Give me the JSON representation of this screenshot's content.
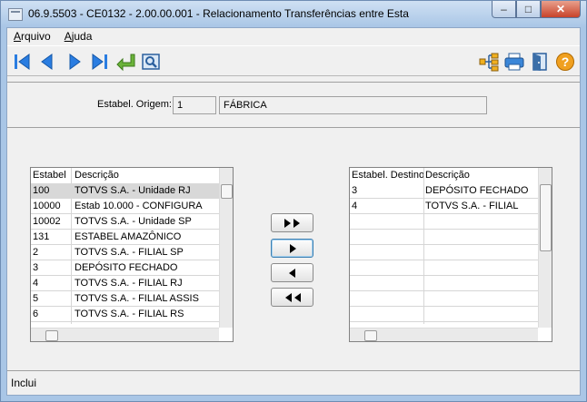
{
  "window": {
    "title": "06.9.5503 - CE0132 - 2.00.00.001 - Relacionamento Transferências entre Esta",
    "minimize_glyph": "–",
    "maximize_glyph": "□",
    "close_glyph": "✕"
  },
  "menu": {
    "items": [
      {
        "accel": "A",
        "rest": "rquivo"
      },
      {
        "accel": "A",
        "rest": "juda"
      }
    ]
  },
  "toolbar": {
    "left_icons": [
      "first-record-icon",
      "previous-record-icon",
      "next-record-icon",
      "last-record-icon",
      "goto-record-icon",
      "search-record-icon"
    ],
    "right_icons": [
      "hierarchy-icon",
      "print-icon",
      "exit-door-icon",
      "help-icon"
    ],
    "colors": {
      "nav_blue": "#2a7de1",
      "goto_green": "#6bb33a",
      "help_orange": "#f0a020"
    }
  },
  "header": {
    "label": "Estabel. Origem:",
    "code": "1",
    "name": "FÁBRICA"
  },
  "left_list": {
    "columns": [
      "Estabel",
      "Descrição"
    ],
    "rows": [
      [
        "100",
        "TOTVS S.A. - Unidade RJ"
      ],
      [
        "10000",
        "Estab 10.000 - CONFIGURA"
      ],
      [
        "10002",
        "TOTVS S.A. - Unidade SP"
      ],
      [
        "131",
        "ESTABEL AMAZÔNICO"
      ],
      [
        "2",
        "TOTVS S.A. - FILIAL SP"
      ],
      [
        "3",
        "DEPÓSITO FECHADO"
      ],
      [
        "4",
        "TOTVS S.A. - FILIAL RJ"
      ],
      [
        "5",
        "TOTVS S.A. - FILIAL ASSIS"
      ],
      [
        "6",
        "TOTVS S.A. - FILIAL RS"
      ]
    ],
    "selected_index": 0
  },
  "right_list": {
    "columns": [
      "Estabel. Destino",
      "Descrição"
    ],
    "rows": [
      [
        "3",
        "DEPÓSITO FECHADO"
      ],
      [
        "4",
        "TOTVS S.A. - FILIAL"
      ]
    ]
  },
  "transfer_buttons": [
    {
      "name": "add-all",
      "icon": "double-right-arrow-icon"
    },
    {
      "name": "add-selected",
      "icon": "right-arrow-icon"
    },
    {
      "name": "remove-selected",
      "icon": "left-arrow-icon"
    },
    {
      "name": "remove-all",
      "icon": "double-left-arrow-icon"
    }
  ],
  "status": {
    "text": "Inclui"
  }
}
